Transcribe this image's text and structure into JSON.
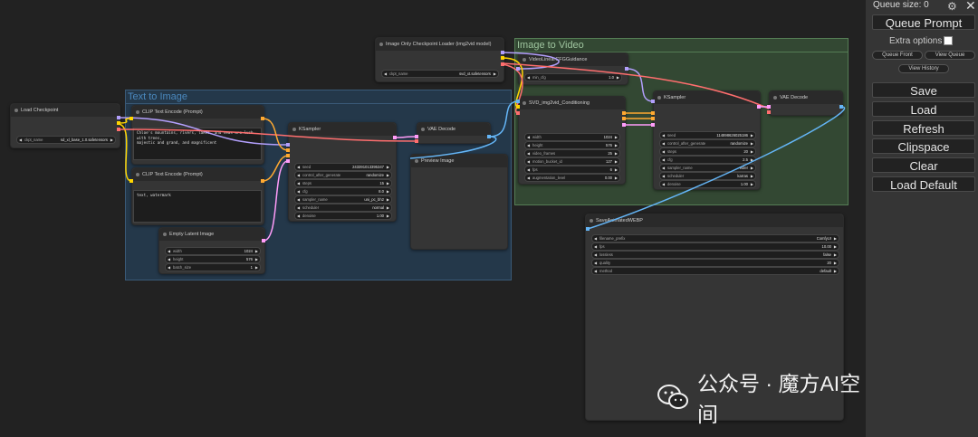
{
  "sidebar": {
    "queue_size": "Queue size: 0",
    "queue_prompt": "Queue Prompt",
    "extra_options": "Extra options",
    "queue_front": "Queue Front",
    "view_queue": "View Queue",
    "view_history": "View History",
    "save": "Save",
    "load": "Load",
    "refresh": "Refresh",
    "clipspace": "Clipspace",
    "clear": "Clear",
    "load_default": "Load Default",
    "close": "✕",
    "gear": "⚙"
  },
  "groups": {
    "text_to_image": "Text to Image",
    "image_to_video": "Image to Video"
  },
  "nodes": {
    "load_checkpoint": {
      "title": "Load Checkpoint",
      "w_ckpt_label": "ckpt_name",
      "w_ckpt_value": "sd_xl_base_1.0.safetensors"
    },
    "clip_pos": {
      "title": "CLIP Text Encode (Prompt)",
      "text": "Chloe's mountains, rivers, lakes, and seas are lush with trees,\nmajestic and grand, and magnificent"
    },
    "clip_neg": {
      "title": "CLIP Text Encode (Prompt)",
      "text": "text, watermark"
    },
    "empty_latent": {
      "title": "Empty Latent Image",
      "widgets": [
        {
          "l": "width",
          "v": "1024"
        },
        {
          "l": "height",
          "v": "576"
        },
        {
          "l": "batch_size",
          "v": "1"
        }
      ]
    },
    "ksampler1": {
      "title": "KSampler",
      "widgets": [
        {
          "l": "seed",
          "v": "243391013395347"
        },
        {
          "l": "control_after_generate",
          "v": "randomize"
        },
        {
          "l": "steps",
          "v": "15"
        },
        {
          "l": "cfg",
          "v": "8.0"
        },
        {
          "l": "sampler_name",
          "v": "uni_pc_bh2"
        },
        {
          "l": "scheduler",
          "v": "normal"
        },
        {
          "l": "denoise",
          "v": "1.00"
        }
      ]
    },
    "vae_decode1": {
      "title": "VAE Decode"
    },
    "preview_image": {
      "title": "Preview Image"
    },
    "img_only_loader": {
      "title": "Image Only Checkpoint Loader (img2vid model)",
      "w_label": "ckpt_name",
      "w_value": "svd_xt.safetensors"
    },
    "video_linear_cfg": {
      "title": "VideoLinearCFGGuidance",
      "w_label": "min_cfg",
      "w_value": "1.0"
    },
    "svd_cond": {
      "title": "SVD_img2vid_Conditioning",
      "widgets": [
        {
          "l": "width",
          "v": "1024"
        },
        {
          "l": "height",
          "v": "576"
        },
        {
          "l": "video_frames",
          "v": "25"
        },
        {
          "l": "motion_bucket_id",
          "v": "127"
        },
        {
          "l": "fps",
          "v": "6"
        },
        {
          "l": "augmentation_level",
          "v": "0.00"
        }
      ]
    },
    "ksampler2": {
      "title": "KSampler",
      "widgets": [
        {
          "l": "seed",
          "v": "114898626025186"
        },
        {
          "l": "control_after_generate",
          "v": "randomize"
        },
        {
          "l": "steps",
          "v": "20"
        },
        {
          "l": "cfg",
          "v": "2.5"
        },
        {
          "l": "sampler_name",
          "v": "euler"
        },
        {
          "l": "scheduler",
          "v": "karras"
        },
        {
          "l": "denoise",
          "v": "1.00"
        }
      ]
    },
    "vae_decode2": {
      "title": "VAE Decode"
    },
    "save_webp": {
      "title": "SaveAnimatedWEBP",
      "widgets": [
        {
          "l": "filename_prefix",
          "v": "ComfyUI"
        },
        {
          "l": "fps",
          "v": "10.00"
        },
        {
          "l": "lossless",
          "v": "false"
        },
        {
          "l": "quality",
          "v": "20"
        },
        {
          "l": "method",
          "v": "default"
        }
      ]
    }
  },
  "watermark": "公众号 · 魔方AI空间",
  "colors": {
    "group_text_to_image": "#2b4a63",
    "group_image_to_video": "#3f5a41",
    "wire_model": "#b29ffc",
    "wire_clip": "#ffd500",
    "wire_vae": "#ff6e6e",
    "wire_conditioning": "#ffa931",
    "wire_latent": "#ff9cf9",
    "wire_image": "#64b5f6"
  }
}
